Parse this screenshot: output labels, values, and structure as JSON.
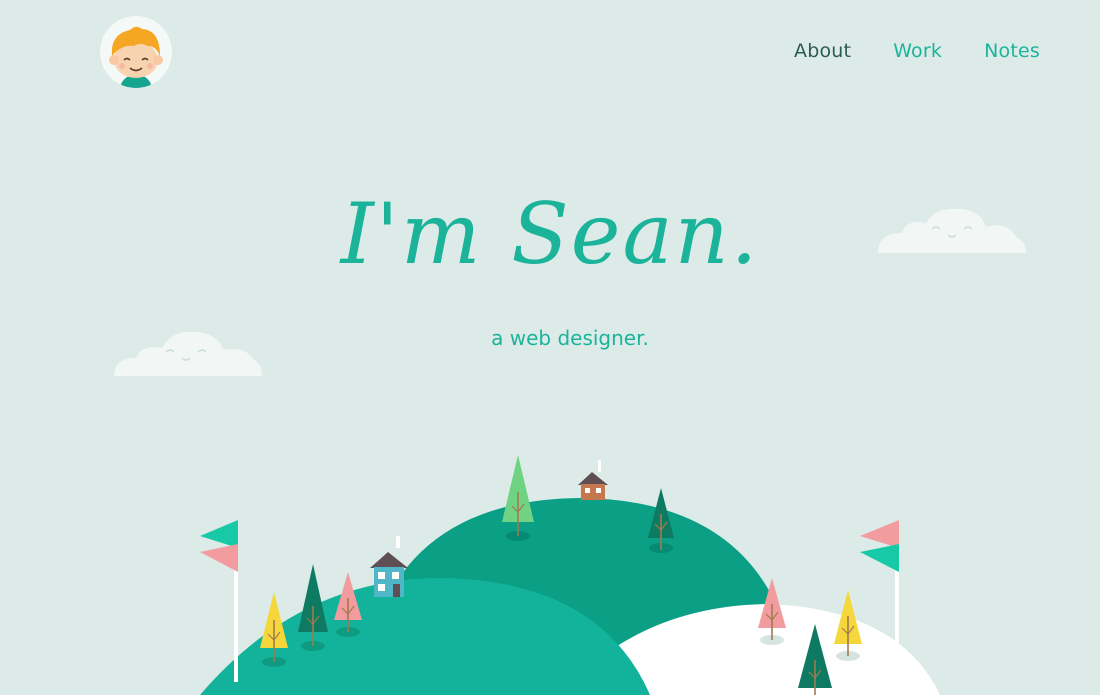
{
  "nav": {
    "items": [
      {
        "label": "About",
        "active": true
      },
      {
        "label": "Work",
        "active": false
      },
      {
        "label": "Notes",
        "active": false
      }
    ]
  },
  "hero": {
    "title": "I'm Sean.",
    "subtitle": "a web designer."
  },
  "colors": {
    "background": "#dcebe8",
    "accent": "#1cb39b",
    "nav_active": "#2f5b55",
    "hill_dark": "#0b9f86",
    "hill_mid": "#12b39a",
    "snow": "#ffffff",
    "tree_pink": "#f29c9f",
    "tree_yellow": "#f5d73c",
    "tree_green": "#0e7a62",
    "tree_light": "#6fd383"
  },
  "icons": [
    "avatar-boy-icon",
    "cloud-icon",
    "house-icon",
    "tree-icon",
    "flag-icon"
  ]
}
